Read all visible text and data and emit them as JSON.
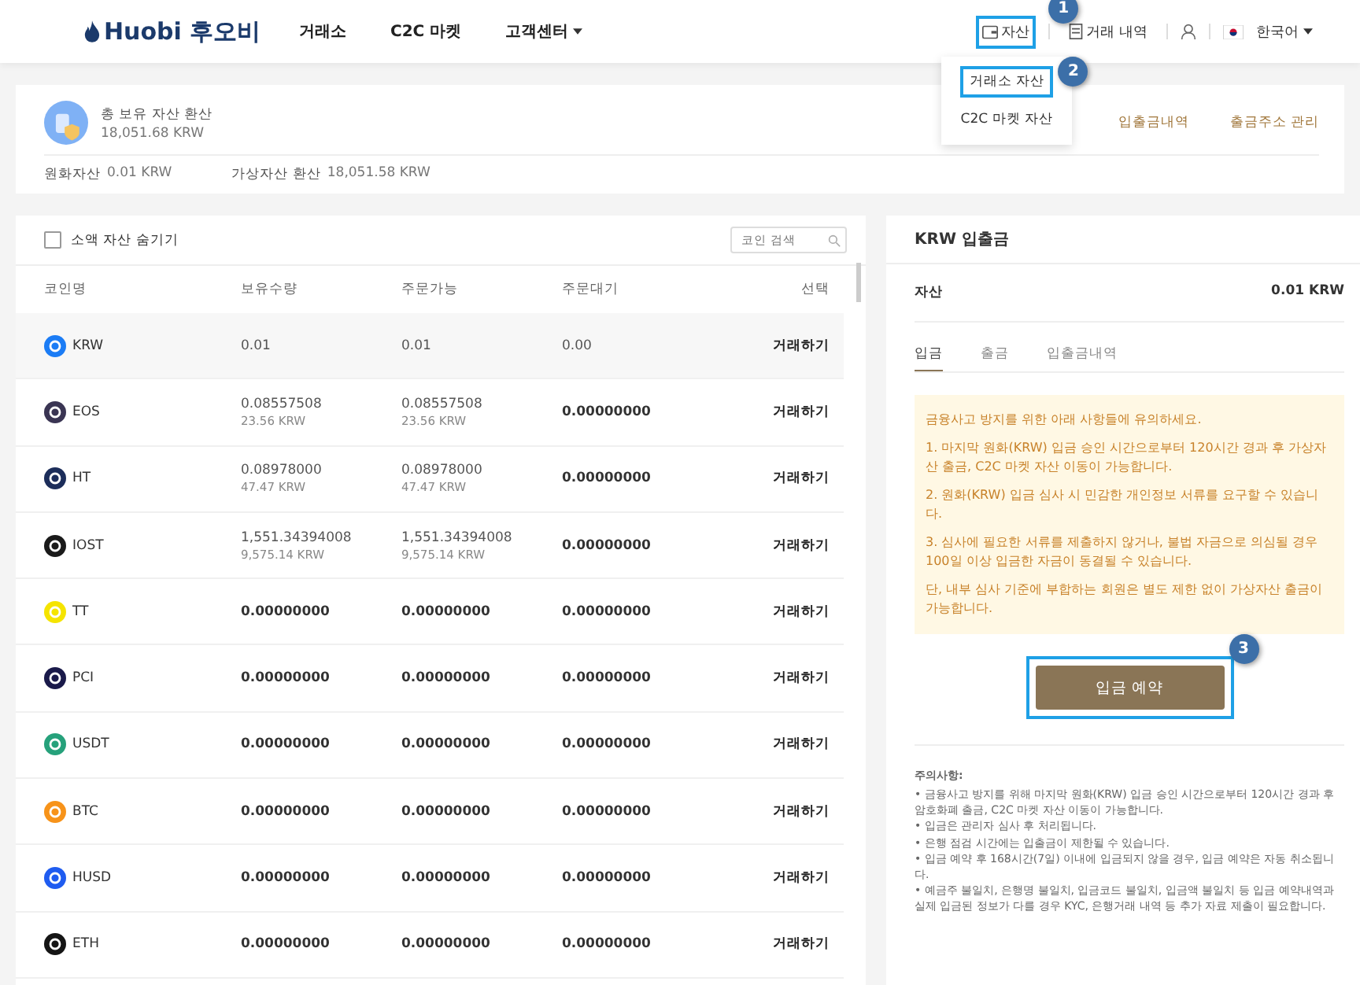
{
  "header": {
    "logo": "Huobi 후오비",
    "nav": [
      {
        "label": "거래소",
        "dropdown": false
      },
      {
        "label": "C2C 마켓",
        "dropdown": false
      },
      {
        "label": "고객센터",
        "dropdown": true
      }
    ],
    "assets_link": {
      "label": "자산",
      "highlighted": true,
      "badge": "1"
    },
    "history_link": "거래 내역",
    "language": "한국어"
  },
  "assets_menu": {
    "expanded": true,
    "items": [
      {
        "label": "거래소 자산",
        "highlighted": true,
        "badge": "2"
      },
      {
        "label": "C2C 마켓 자산",
        "highlighted": false
      }
    ]
  },
  "summary": {
    "title": "총 보유 자산 환산",
    "total": "18,051.68 KRW",
    "links": [
      "입출금내역",
      "출금주소 관리"
    ],
    "krw_label": "원화자산",
    "krw_value": "0.01 KRW",
    "crypto_label": "가상자산 환산",
    "crypto_value": "18,051.58 KRW"
  },
  "asset_table": {
    "hide_small": {
      "label": "소액 자산 숨기기",
      "checked": false
    },
    "search_placeholder": "코인 검색",
    "columns": [
      "코인명",
      "보유수량",
      "주문가능",
      "주문대기",
      "선택"
    ],
    "rows": [
      {
        "coin": "KRW",
        "color": "#1b7cf5",
        "balance": "0.01",
        "balance_sub": "",
        "available": "0.01",
        "available_sub": "",
        "pending": "0.00",
        "action": "거래하기",
        "selected": true
      },
      {
        "coin": "EOS",
        "color": "#3a3553",
        "balance": "0.08557508",
        "balance_sub": "23.56 KRW",
        "available": "0.08557508",
        "available_sub": "23.56 KRW",
        "pending": "0.00000000",
        "action": "거래하기",
        "selected": false
      },
      {
        "coin": "HT",
        "color": "#1c2d5a",
        "balance": "0.08978000",
        "balance_sub": "47.47 KRW",
        "available": "0.08978000",
        "available_sub": "47.47 KRW",
        "pending": "0.00000000",
        "action": "거래하기",
        "selected": false
      },
      {
        "coin": "IOST",
        "color": "#1a1a1a",
        "balance": "1,551.34394008",
        "balance_sub": "9,575.14 KRW",
        "available": "1,551.34394008",
        "available_sub": "9,575.14 KRW",
        "pending": "0.00000000",
        "action": "거래하기",
        "selected": false
      },
      {
        "coin": "TT",
        "color": "#f5e400",
        "balance": "0.00000000",
        "balance_sub": "",
        "available": "0.00000000",
        "available_sub": "",
        "pending": "0.00000000",
        "action": "거래하기",
        "selected": false
      },
      {
        "coin": "PCI",
        "color": "#1a1a4a",
        "balance": "0.00000000",
        "balance_sub": "",
        "available": "0.00000000",
        "available_sub": "",
        "pending": "0.00000000",
        "action": "거래하기",
        "selected": false
      },
      {
        "coin": "USDT",
        "color": "#26a17b",
        "balance": "0.00000000",
        "balance_sub": "",
        "available": "0.00000000",
        "available_sub": "",
        "pending": "0.00000000",
        "action": "거래하기",
        "selected": false
      },
      {
        "coin": "BTC",
        "color": "#f7931a",
        "balance": "0.00000000",
        "balance_sub": "",
        "available": "0.00000000",
        "available_sub": "",
        "pending": "0.00000000",
        "action": "거래하기",
        "selected": false
      },
      {
        "coin": "HUSD",
        "color": "#1f5cf0",
        "balance": "0.00000000",
        "balance_sub": "",
        "available": "0.00000000",
        "available_sub": "",
        "pending": "0.00000000",
        "action": "거래하기",
        "selected": false
      },
      {
        "coin": "ETH",
        "color": "#151515",
        "balance": "0.00000000",
        "balance_sub": "",
        "available": "0.00000000",
        "available_sub": "",
        "pending": "0.00000000",
        "action": "거래하기",
        "selected": false
      }
    ]
  },
  "krw_panel": {
    "title": "KRW 입출금",
    "asset_label": "자산",
    "asset_value": "0.01 KRW",
    "tabs": [
      {
        "label": "입금",
        "selected": true
      },
      {
        "label": "출금",
        "selected": false
      },
      {
        "label": "입출금내역",
        "selected": false
      }
    ],
    "notice": [
      "금융사고 방지를 위한 아래 사항들에 유의하세요.",
      "1. 마지막 원화(KRW) 입금 승인 시간으로부터 120시간 경과 후 가상자산 출금, C2C 마켓 자산 이동이 가능합니다.",
      "2. 원화(KRW) 입금 심사 시 민감한 개인정보 서류를 요구할 수 있습니다.",
      "3. 심사에 필요한 서류를 제출하지 않거나, 불법 자금으로 의심될 경우 100일 이상 입금한 자금이 동결될 수 있습니다.",
      "단, 내부 심사 기준에 부합하는 회원은 별도 제한 없이 가상자산 출금이 가능합니다."
    ],
    "button": {
      "label": "입금 예약",
      "highlighted": true,
      "badge": "3"
    },
    "notes_title": "주의사항:",
    "notes": [
      "• 금융사고 방지를 위해 마지막 원화(KRW) 입금 승인 시간으로부터 120시간 경과 후 암호화폐 출금, C2C 마켓 자산 이동이 가능합니다.",
      "• 입금은 관리자 심사 후 처리됩니다.",
      "• 은행 점검 시간에는 입출금이 제한될 수 있습니다.",
      "• 입금 예약 후 168시간(7일) 이내에 입금되지 않을 경우, 입금 예약은 자동 취소됩니다.",
      "• 예금주 불일치, 은행명 불일치, 입금코드 불일치, 입금액 불일치 등 입금 예약내역과 실제 입금된 정보가 다를 경우 KYC, 은행거래 내역 등 추가 자료 제출이 필요합니다."
    ]
  }
}
